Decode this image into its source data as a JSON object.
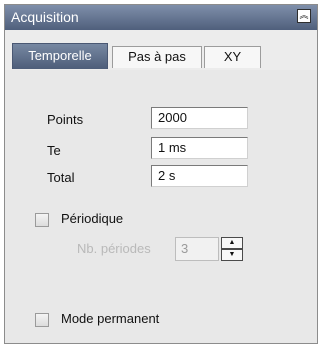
{
  "panel": {
    "title": "Acquisition",
    "collapse_icon": "chevron-double-up-icon"
  },
  "tabs": [
    {
      "label": "Temporelle",
      "active": true
    },
    {
      "label": "Pas à pas",
      "active": false
    },
    {
      "label": "XY",
      "active": false
    }
  ],
  "fields": {
    "points": {
      "label": "Points",
      "value": "2000"
    },
    "te": {
      "label": "Te",
      "value": "1 ms"
    },
    "total": {
      "label": "Total",
      "value": "2 s"
    }
  },
  "periodique": {
    "label": "Périodique",
    "checked": false,
    "nb_periodes_label": "Nb. périodes",
    "nb_periodes_value": "3"
  },
  "mode_permanent": {
    "label": "Mode permanent",
    "checked": false
  }
}
